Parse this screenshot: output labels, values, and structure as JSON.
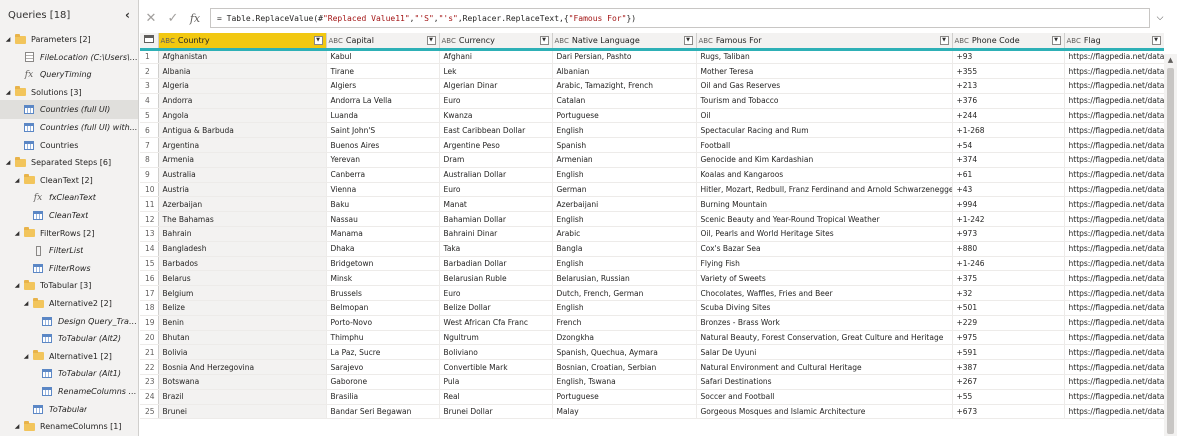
{
  "queries": {
    "title": "Queries [18]",
    "items": [
      {
        "label": "Parameters [2]",
        "icon": "folder-icon",
        "expander": "open",
        "indent": 0
      },
      {
        "label": "FileLocation (C:\\Users\\l...",
        "icon": "file-icon",
        "indent": 1,
        "italic": true
      },
      {
        "label": "QueryTiming",
        "icon": "function-icon",
        "indent": 1,
        "italic": true
      },
      {
        "label": "Solutions [3]",
        "icon": "folder-icon",
        "expander": "open",
        "indent": 0
      },
      {
        "label": "Countries (full UI)",
        "icon": "table-icon",
        "indent": 1,
        "italic": true,
        "selected": true
      },
      {
        "label": "Countries (full UI) with...",
        "icon": "table-icon",
        "indent": 1,
        "italic": true
      },
      {
        "label": "Countries",
        "icon": "table-icon",
        "indent": 1,
        "italic": false
      },
      {
        "label": "Separated Steps [6]",
        "icon": "folder-icon",
        "expander": "open",
        "indent": 0
      },
      {
        "label": "CleanText [2]",
        "icon": "folder-icon",
        "expander": "open",
        "indent": 1
      },
      {
        "label": "fxCleanText",
        "icon": "function-icon",
        "indent": 2,
        "italic": true
      },
      {
        "label": "CleanText",
        "icon": "table-icon",
        "indent": 2,
        "italic": true
      },
      {
        "label": "FilterRows [2]",
        "icon": "folder-icon",
        "expander": "open",
        "indent": 1
      },
      {
        "label": "FilterList",
        "icon": "list-icon",
        "indent": 2,
        "italic": true
      },
      {
        "label": "FilterRows",
        "icon": "table-icon",
        "indent": 2,
        "italic": true
      },
      {
        "label": "ToTabular [3]",
        "icon": "folder-icon",
        "expander": "open",
        "indent": 1
      },
      {
        "label": "Alternative2 [2]",
        "icon": "folder-icon",
        "expander": "open",
        "indent": 2
      },
      {
        "label": "Design Query_Trans...",
        "icon": "table-icon",
        "indent": 3,
        "italic": true
      },
      {
        "label": "ToTabular (Alt2)",
        "icon": "table-icon",
        "indent": 3,
        "italic": true
      },
      {
        "label": "Alternative1 [2]",
        "icon": "folder-icon",
        "expander": "open",
        "indent": 2
      },
      {
        "label": "ToTabular (Alt1)",
        "icon": "table-icon",
        "indent": 3,
        "italic": true
      },
      {
        "label": "RenameColumns (A...",
        "icon": "table-icon",
        "indent": 3,
        "italic": true
      },
      {
        "label": "ToTabular",
        "icon": "table-icon",
        "indent": 2,
        "italic": true
      },
      {
        "label": "RenameColumns [1]",
        "icon": "folder-icon",
        "expander": "open",
        "indent": 1
      }
    ]
  },
  "formula_bar": {
    "cancel_glyph": "✕",
    "confirm_glyph": "✓",
    "fx_label": "fx",
    "formula": "= Table.ReplaceValue(#\"Replaced Value11\",\"'S\",\"'s\",Replacer.ReplaceText,{\"Famous For\"})",
    "expand_glyph": "⌵"
  },
  "grid": {
    "type_label": "ABC",
    "columns": [
      "Country",
      "Capital",
      "Currency",
      "Native Language",
      "Famous For",
      "Phone Code",
      "Flag"
    ],
    "selected_column": 0,
    "rows": [
      [
        "Afghanistan",
        "Kabul",
        "Afghani",
        "Dari Persian, Pashto",
        "Rugs, Taliban",
        "+93",
        "https://flagpedia.net/data"
      ],
      [
        "Albania",
        "Tirane",
        "Lek",
        "Albanian",
        "Mother Teresa",
        "+355",
        "https://flagpedia.net/data"
      ],
      [
        "Algeria",
        "Algiers",
        "Algerian Dinar",
        "Arabic, Tamazight, French",
        "Oil and Gas Reserves",
        "+213",
        "https://flagpedia.net/data"
      ],
      [
        "Andorra",
        "Andorra La Vella",
        "Euro",
        "Catalan",
        "Tourism and Tobacco",
        "+376",
        "https://flagpedia.net/data"
      ],
      [
        "Angola",
        "Luanda",
        "Kwanza",
        "Portuguese",
        "Oil",
        "+244",
        "https://flagpedia.net/data"
      ],
      [
        "Antigua & Barbuda",
        "Saint John'S",
        "East Caribbean Dollar",
        "English",
        "Spectacular Racing and Rum",
        "+1-268",
        "https://flagpedia.net/data"
      ],
      [
        "Argentina",
        "Buenos Aires",
        "Argentine Peso",
        "Spanish",
        "Football",
        "+54",
        "https://flagpedia.net/data"
      ],
      [
        "Armenia",
        "Yerevan",
        "Dram",
        "Armenian",
        "Genocide and Kim Kardashian",
        "+374",
        "https://flagpedia.net/data"
      ],
      [
        "Australia",
        "Canberra",
        "Australian Dollar",
        "English",
        "Koalas and Kangaroos",
        "+61",
        "https://flagpedia.net/data"
      ],
      [
        "Austria",
        "Vienna",
        "Euro",
        "German",
        "Hitler, Mozart, Redbull, Franz Ferdinand and Arnold Schwarzenegger",
        "+43",
        "https://flagpedia.net/data"
      ],
      [
        "Azerbaijan",
        "Baku",
        "Manat",
        "Azerbaijani",
        "Burning Mountain",
        "+994",
        "https://flagpedia.net/data"
      ],
      [
        "The Bahamas",
        "Nassau",
        "Bahamian Dollar",
        "English",
        "Scenic Beauty and Year-Round Tropical Weather",
        "+1-242",
        "https://flagpedia.net/data"
      ],
      [
        "Bahrain",
        "Manama",
        "Bahraini Dinar",
        "Arabic",
        "Oil, Pearls and World Heritage Sites",
        "+973",
        "https://flagpedia.net/data"
      ],
      [
        "Bangladesh",
        "Dhaka",
        "Taka",
        "Bangla",
        "Cox's Bazar Sea",
        "+880",
        "https://flagpedia.net/data"
      ],
      [
        "Barbados",
        "Bridgetown",
        "Barbadian Dollar",
        "English",
        "Flying Fish",
        "+1-246",
        "https://flagpedia.net/data"
      ],
      [
        "Belarus",
        "Minsk",
        "Belarusian Ruble",
        "Belarusian, Russian",
        "Variety of Sweets",
        "+375",
        "https://flagpedia.net/data"
      ],
      [
        "Belgium",
        "Brussels",
        "Euro",
        "Dutch, French, German",
        "Chocolates, Waffles, Fries and Beer",
        "+32",
        "https://flagpedia.net/data"
      ],
      [
        "Belize",
        "Belmopan",
        "Belize Dollar",
        "English",
        "Scuba Diving Sites",
        "+501",
        "https://flagpedia.net/data"
      ],
      [
        "Benin",
        "Porto-Novo",
        "West African Cfa Franc",
        "French",
        "Bronzes - Brass Work",
        "+229",
        "https://flagpedia.net/data"
      ],
      [
        "Bhutan",
        "Thimphu",
        "Ngultrum",
        "Dzongkha",
        "Natural Beauty, Forest Conservation, Great Culture and Heritage",
        "+975",
        "https://flagpedia.net/data"
      ],
      [
        "Bolivia",
        "La Paz, Sucre",
        "Boliviano",
        "Spanish, Quechua, Aymara",
        "Salar De Uyuni",
        "+591",
        "https://flagpedia.net/data"
      ],
      [
        "Bosnia And Herzegovina",
        "Sarajevo",
        "Convertible Mark",
        "Bosnian, Croatian, Serbian",
        "Natural Environment and Cultural Heritage",
        "+387",
        "https://flagpedia.net/data"
      ],
      [
        "Botswana",
        "Gaborone",
        "Pula",
        "English, Tswana",
        "Safari Destinations",
        "+267",
        "https://flagpedia.net/data"
      ],
      [
        "Brazil",
        "Brasilia",
        "Real",
        "Portuguese",
        "Soccer and Football",
        "+55",
        "https://flagpedia.net/data"
      ],
      [
        "Brunei",
        "Bandar Seri Begawan",
        "Brunei Dollar",
        "Malay",
        "Gorgeous Mosques and Islamic Architecture",
        "+673",
        "https://flagpedia.net/data"
      ]
    ]
  },
  "colors": {
    "selected_header": "#f2c811",
    "quality_bar": "#2eb0b6",
    "folder": "#f2c55c",
    "table_icon": "#5b87c5"
  }
}
